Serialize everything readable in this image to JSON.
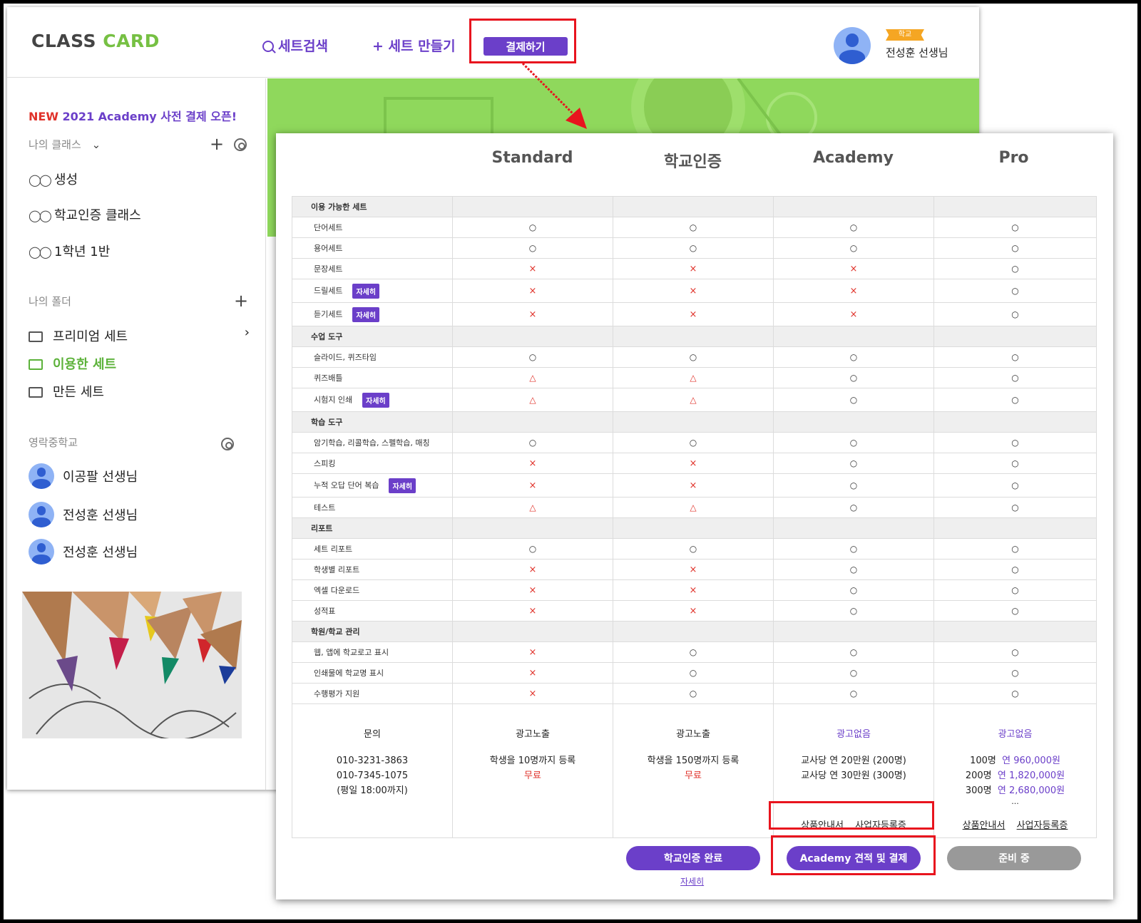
{
  "header": {
    "logo_part1": "CLASS",
    "logo_part2": "CARD",
    "search_label": "세트검색",
    "create_label": "+ 세트 만들기",
    "pay_label": "결제하기",
    "user_badge": "학교",
    "user_name": "전성훈 선생님"
  },
  "sidebar": {
    "promo_new": "NEW",
    "promo_text": "2021 Academy 사전 결제 오픈!",
    "my_class_title": "나의 클래스",
    "classes": [
      "생성",
      "학교인증 클래스",
      "1학년 1반"
    ],
    "my_folder_title": "나의 폴더",
    "folders": [
      "프리미엄 세트",
      "이용한 세트",
      "만든 세트"
    ],
    "school_title": "영락중학교",
    "teachers": [
      "이공팔 선생님",
      "전성훈 선생님",
      "전성훈 선생님"
    ]
  },
  "plans": [
    "Standard",
    "학교인증",
    "Academy",
    "Pro"
  ],
  "detail_label": "자세히",
  "table": [
    {
      "type": "cat",
      "label": "이용 가능한 세트"
    },
    {
      "label": "단어세트",
      "marks": [
        "o",
        "o",
        "o",
        "o"
      ]
    },
    {
      "label": "용어세트",
      "marks": [
        "o",
        "o",
        "o",
        "o"
      ]
    },
    {
      "label": "문장세트",
      "marks": [
        "x",
        "x",
        "x",
        "o"
      ]
    },
    {
      "label": "드릴세트",
      "detail": true,
      "marks": [
        "x",
        "x",
        "x",
        "o"
      ]
    },
    {
      "label": "듣기세트",
      "detail": true,
      "marks": [
        "x",
        "x",
        "x",
        "o"
      ]
    },
    {
      "type": "cat",
      "label": "수업 도구"
    },
    {
      "label": "슬라이드, 퀴즈타임",
      "marks": [
        "o",
        "o",
        "o",
        "o"
      ]
    },
    {
      "label": "퀴즈배틀",
      "marks": [
        "t",
        "t",
        "o",
        "o"
      ]
    },
    {
      "label": "시험지 인쇄",
      "detail": true,
      "marks": [
        "t",
        "t",
        "o",
        "o"
      ]
    },
    {
      "type": "cat",
      "label": "학습 도구"
    },
    {
      "label": "암기학습, 리콜학습, 스펠학습, 매칭",
      "marks": [
        "o",
        "o",
        "o",
        "o"
      ]
    },
    {
      "label": "스피킹",
      "marks": [
        "x",
        "x",
        "o",
        "o"
      ]
    },
    {
      "label": "누적 오답 단어 복습",
      "detail": true,
      "marks": [
        "x",
        "x",
        "o",
        "o"
      ]
    },
    {
      "label": "테스트",
      "marks": [
        "t",
        "t",
        "o",
        "o"
      ]
    },
    {
      "type": "cat",
      "label": "리포트"
    },
    {
      "label": "세트 리포트",
      "marks": [
        "o",
        "o",
        "o",
        "o"
      ]
    },
    {
      "label": "학생별 리포트",
      "marks": [
        "x",
        "x",
        "o",
        "o"
      ]
    },
    {
      "label": "엑셀 다운로드",
      "marks": [
        "x",
        "x",
        "o",
        "o"
      ]
    },
    {
      "label": "성적표",
      "marks": [
        "x",
        "x",
        "o",
        "o"
      ]
    },
    {
      "type": "cat",
      "label": "학원/학교 관리"
    },
    {
      "label": "웹, 앱에 학교로고 표시",
      "marks": [
        "x",
        "o",
        "o",
        "o"
      ]
    },
    {
      "label": "인쇄물에 학교명 표시",
      "marks": [
        "x",
        "o",
        "o",
        "o"
      ]
    },
    {
      "label": "수행평가 지원",
      "marks": [
        "x",
        "o",
        "o",
        "o"
      ]
    }
  ],
  "marks": {
    "o": "○",
    "x": "×",
    "t": "△"
  },
  "summary": {
    "contact": {
      "title": "문의",
      "phone1": "010-3231-3863",
      "phone2": "010-7345-1075",
      "hours": "(평일 18:00까지)"
    },
    "standard": {
      "title": "광고노출",
      "desc": "학생을 10명까지 등록",
      "price": "무료"
    },
    "school": {
      "title": "광고노출",
      "desc": "학생을 150명까지 등록",
      "price": "무료"
    },
    "academy": {
      "title": "광고없음",
      "line1": "교사당 연 20만원 (200명)",
      "line2": "교사당 연 30만원 (300명)",
      "link1": "상품안내서",
      "link2": "사업자등록증"
    },
    "pro": {
      "title": "광고없음",
      "rows": [
        {
          "n": "100명",
          "p": "연 960,000원"
        },
        {
          "n": "200명",
          "p": "연 1,820,000원"
        },
        {
          "n": "300명",
          "p": "연 2,680,000원"
        }
      ],
      "more": "...",
      "link1": "상품안내서",
      "link2": "사업자등록증"
    }
  },
  "buttons": {
    "school_done": "학교인증 완료",
    "academy_pay": "Academy 견적 및 결제",
    "pro_ready": "준비 중",
    "detail_link": "자세히"
  },
  "colors": {
    "accent": "#6b3fc9",
    "green": "#76c043",
    "red": "#e0322a",
    "highlight": "#e8141e"
  }
}
